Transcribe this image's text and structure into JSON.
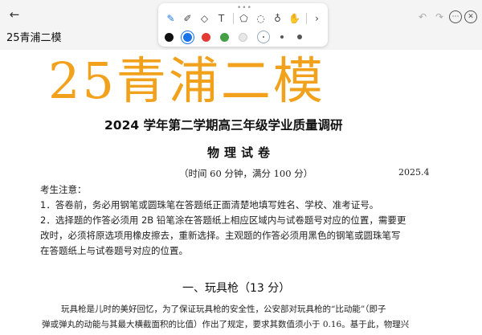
{
  "header": {
    "back_icon": "←",
    "note_title": "25青浦二模"
  },
  "toolbar": {
    "drag_handle": "•••",
    "tools": [
      {
        "name": "pen-icon",
        "glyph": "✎",
        "active": true
      },
      {
        "name": "pencil-icon",
        "glyph": "✐",
        "active": false
      },
      {
        "name": "eraser-icon",
        "glyph": "◇",
        "active": false
      },
      {
        "name": "text-tool-icon",
        "glyph": "T",
        "active": false
      },
      {
        "name": "shape-icon",
        "glyph": "⬠",
        "active": false
      },
      {
        "name": "lasso-icon",
        "glyph": "◌",
        "active": false
      },
      {
        "name": "microphone-icon",
        "glyph": "♁",
        "active": false
      },
      {
        "name": "hand-icon",
        "glyph": "✋",
        "active": false
      },
      {
        "name": "chevron-right-icon",
        "glyph": "›",
        "active": false
      }
    ],
    "colors": [
      "#111111",
      "#1a73e8",
      "#e53935",
      "#43a047",
      "#e8e8e8"
    ],
    "selected_color": "#1a73e8",
    "sizes": [
      1.5,
      3,
      5
    ],
    "selected_size": 1.5,
    "right_tools": [
      {
        "name": "undo-icon",
        "glyph": "↶",
        "disabled": true
      },
      {
        "name": "redo-icon",
        "glyph": "↷",
        "disabled": true
      },
      {
        "name": "more-icon",
        "glyph": "⋯",
        "disabled": false
      },
      {
        "name": "close-icon",
        "glyph": "✕",
        "disabled": false
      }
    ]
  },
  "document": {
    "overlay_title": "25青浦二模",
    "exam_title": "2024 学年第二学期高三年级学业质量调研",
    "subject": "物理试卷",
    "meta": "（时间 60 分钟，满分 100 分）",
    "date": "2025.4",
    "notice_lines": [
      "考生注意：",
      "1．答卷前，务必用钢笔或圆珠笔在答题纸正面清楚地填写姓名、学校、准考证号。",
      "2．选择题的作答必须用 2B 铅笔涂在答题纸上相应区域内与试卷题号对应的位置，需要更",
      "改时，必须将原选项用橡皮擦去，重新选择。主观题的作答必须用黑色的钢笔或圆珠笔写",
      "在答题纸上与试卷题号对应的位置。"
    ],
    "section_heading": "一、玩具枪（13 分）",
    "body_lines": [
      "玩具枪是儿时的美好回忆，为了保证玩具枪的安全性，公安部对玩具枪的“比动能”（即子",
      "弹或弹丸的动能与其最大横截面积的比值）作出了规定，要求其数值须小于 0.16。基于此，物理兴"
    ]
  }
}
